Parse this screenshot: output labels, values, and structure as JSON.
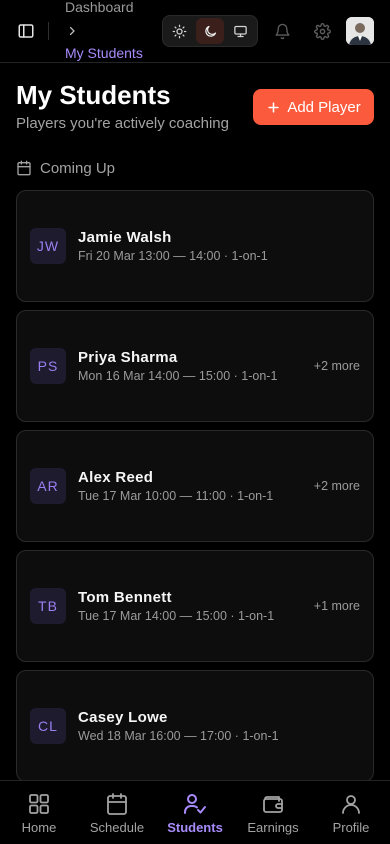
{
  "header": {
    "breadcrumb_parent": "Dashboard",
    "breadcrumb_current": "My Students",
    "theme_modes": [
      "light",
      "dark",
      "system"
    ],
    "active_theme": "dark"
  },
  "page": {
    "title": "My Students",
    "subtitle": "Players you're actively coaching",
    "add_button_label": "Add Player"
  },
  "section": {
    "title": "Coming Up"
  },
  "students": [
    {
      "initials": "JW",
      "name": "Jamie Walsh",
      "time": "Fri 20 Mar 13:00 — 14:00 · 1-on-1",
      "more": ""
    },
    {
      "initials": "PS",
      "name": "Priya Sharma",
      "time": "Mon 16 Mar 14:00 — 15:00 · 1-on-1",
      "more": "+2 more"
    },
    {
      "initials": "AR",
      "name": "Alex Reed",
      "time": "Tue 17 Mar 10:00 — 11:00 · 1-on-1",
      "more": "+2 more"
    },
    {
      "initials": "TB",
      "name": "Tom Bennett",
      "time": "Tue 17 Mar 14:00 — 15:00 · 1-on-1",
      "more": "+1 more"
    },
    {
      "initials": "CL",
      "name": "Casey Lowe",
      "time": "Wed 18 Mar 16:00 — 17:00 · 1-on-1",
      "more": ""
    }
  ],
  "nav": {
    "items": [
      {
        "label": "Home",
        "icon": "grid-icon"
      },
      {
        "label": "Schedule",
        "icon": "calendar-icon"
      },
      {
        "label": "Students",
        "icon": "users-check-icon"
      },
      {
        "label": "Earnings",
        "icon": "wallet-icon"
      },
      {
        "label": "Profile",
        "icon": "user-icon"
      }
    ],
    "active": "Students"
  },
  "colors": {
    "accent": "#a78bfa",
    "primary_button": "#fb5a3c",
    "background": "#000000"
  }
}
